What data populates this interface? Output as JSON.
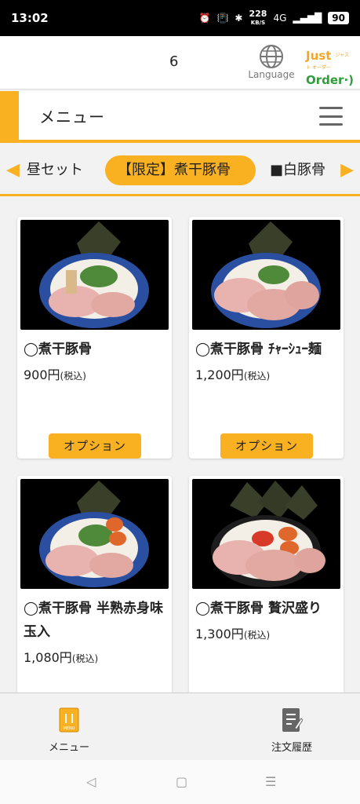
{
  "status": {
    "time": "13:02",
    "speed_value": "228",
    "speed_unit": "KB/S",
    "network": "4G",
    "battery": "90"
  },
  "header": {
    "table_number": "6",
    "language_label": "Language",
    "logo_line1": "Just",
    "logo_line2": "Order",
    "logo_small": "ジャスト オーダー"
  },
  "titlebar": {
    "title": "メニュー"
  },
  "categories": {
    "items": [
      {
        "label": "昼セット"
      },
      {
        "label": "【限定】煮干豚骨"
      },
      {
        "label": "■白豚骨"
      }
    ],
    "active_index": 1
  },
  "cards": [
    {
      "name": "◯煮干豚骨",
      "price": "900円",
      "tax": "(税込)",
      "option_label": "オプション"
    },
    {
      "name": "◯煮干豚骨 ﾁｬｰｼｭｰ麺",
      "price": "1,200円",
      "tax": "(税込)",
      "option_label": "オプション"
    },
    {
      "name": "◯煮干豚骨 半熟赤身味玉入",
      "price": "1,080円",
      "tax": "(税込)"
    },
    {
      "name": "◯煮干豚骨 贅沢盛り",
      "price": "1,300円",
      "tax": "(税込)"
    }
  ],
  "bottom_nav": {
    "menu_label": "メニュー",
    "history_label": "注文履歴",
    "menu_icon_text": "MENU"
  },
  "colors": {
    "accent": "#f9b021",
    "logo_green": "#2f9e3a"
  },
  "icons": {
    "globe": "globe-icon",
    "hamburger": "hamburger-icon",
    "menu": "menu-book-icon",
    "history": "order-history-icon"
  }
}
